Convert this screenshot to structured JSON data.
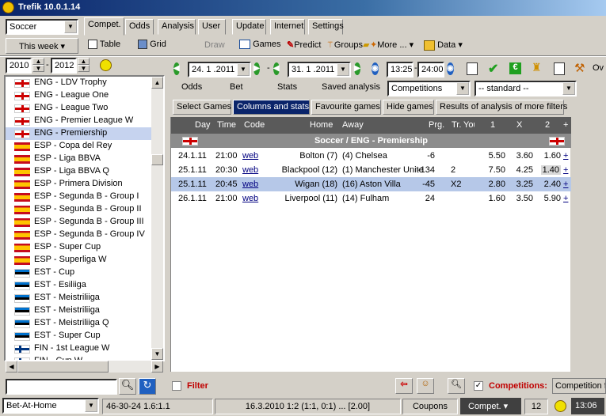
{
  "app": {
    "title": "Trefik 10.0.1.14"
  },
  "sport_select": {
    "value": "Soccer"
  },
  "tabs": [
    {
      "label": "Compet."
    },
    {
      "label": "Odds"
    },
    {
      "label": "Analysis"
    },
    {
      "label": "User"
    },
    {
      "label": "Update"
    },
    {
      "label": "Internet"
    },
    {
      "label": "Settings"
    }
  ],
  "toolbar": {
    "period": "This week",
    "table": "Table",
    "grid": "Grid",
    "draw": "Draw",
    "games": "Games",
    "predict": "Predict",
    "groups": "Groups",
    "more": "More ...",
    "data": "Data"
  },
  "years": {
    "from": "2010",
    "to": "2012"
  },
  "dates": {
    "from": "24. 1 .2011",
    "to": "31. 1 .2011",
    "time_from": "13:25",
    "time_to": "24:00"
  },
  "view_links": {
    "odds": "Odds",
    "bet": "Bet",
    "stats": "Stats",
    "saved": "Saved analysis"
  },
  "competitions_select": "Competitions",
  "standard_select": "-- standard --",
  "ov_label": "Ov",
  "subtabs": [
    "Select Games",
    "Columns and stats",
    "Favourite games",
    "Hide games",
    "Results of analysis of more filters"
  ],
  "sidebar": {
    "items": [
      {
        "label": "ENG - LDV Trophy",
        "flag": "eng"
      },
      {
        "label": "ENG - League One",
        "flag": "eng"
      },
      {
        "label": "ENG - League Two",
        "flag": "eng"
      },
      {
        "label": "ENG - Premier League W",
        "flag": "eng"
      },
      {
        "label": "ENG - Premiership",
        "flag": "eng",
        "selected": true
      },
      {
        "label": "ESP - Copa del Rey",
        "flag": "esp"
      },
      {
        "label": "ESP - Liga BBVA",
        "flag": "esp"
      },
      {
        "label": "ESP - Liga BBVA Q",
        "flag": "esp"
      },
      {
        "label": "ESP - Primera Division",
        "flag": "esp"
      },
      {
        "label": "ESP - Segunda B - Group I",
        "flag": "esp"
      },
      {
        "label": "ESP - Segunda B - Group II",
        "flag": "esp"
      },
      {
        "label": "ESP - Segunda B - Group III",
        "flag": "esp"
      },
      {
        "label": "ESP - Segunda B - Group IV",
        "flag": "esp"
      },
      {
        "label": "ESP - Super Cup",
        "flag": "esp"
      },
      {
        "label": "ESP - Superliga W",
        "flag": "esp"
      },
      {
        "label": "EST - Cup",
        "flag": "est"
      },
      {
        "label": "EST - Esiliiga",
        "flag": "est"
      },
      {
        "label": "EST - Meistriliiga",
        "flag": "est"
      },
      {
        "label": "EST - Meistriliiga",
        "flag": "est"
      },
      {
        "label": "EST - Meistriliiga Q",
        "flag": "est"
      },
      {
        "label": "EST - Super Cup",
        "flag": "est"
      },
      {
        "label": "FIN - 1st League W",
        "flag": "fin"
      },
      {
        "label": "FIN - Cup W",
        "flag": "fin"
      }
    ]
  },
  "grid": {
    "headers": {
      "day": "Day",
      "time": "Time",
      "code": "Code",
      "home": "Home",
      "away": "Away",
      "prg": "Prg.",
      "tr": "Tr.",
      "you": "You",
      "h1": "1",
      "hx": "X",
      "h2": "2",
      "plus": "+"
    },
    "competition": "Soccer / ENG - Premiership",
    "rows": [
      {
        "day": "24.1.11",
        "time": "21:00",
        "code": "web",
        "home": "Bolton (7)",
        "away": "(4) Chelsea",
        "prg": "-6",
        "tr": "",
        "o1": "5.50",
        "ox": "3.60",
        "o2": "1.60",
        "plus": "+"
      },
      {
        "day": "25.1.11",
        "time": "20:30",
        "code": "web",
        "home": "Blackpool (12)",
        "away": "(1) Manchester Unite",
        "prg": "-134",
        "tr": "2",
        "o1": "7.50",
        "ox": "4.25",
        "o2": "1.40",
        "plus": "+"
      },
      {
        "day": "25.1.11",
        "time": "20:45",
        "code": "web",
        "home": "Wigan (18)",
        "away": "(16) Aston Villa",
        "prg": "-45",
        "tr": "X2",
        "o1": "2.80",
        "ox": "3.25",
        "o2": "2.40",
        "plus": "+",
        "selected": true
      },
      {
        "day": "26.1.11",
        "time": "21:00",
        "code": "web",
        "home": "Liverpool (11)",
        "away": "(14) Fulham",
        "prg": "24",
        "tr": "",
        "o1": "1.60",
        "ox": "3.50",
        "o2": "5.90",
        "plus": "+"
      }
    ]
  },
  "bottom": {
    "filter": "Filter",
    "competitions": "Competitions:",
    "competition_value": "Competition f"
  },
  "status": {
    "bookmaker": "Bet-At-Home",
    "record": "46-30-24  1.6:1.1",
    "date_info": "16.3.2010 1:2 (1:1, 0:1) ... [2.00]",
    "coupons": "Coupons",
    "compet": "Compet.",
    "count": "12",
    "clock": "13:06"
  }
}
